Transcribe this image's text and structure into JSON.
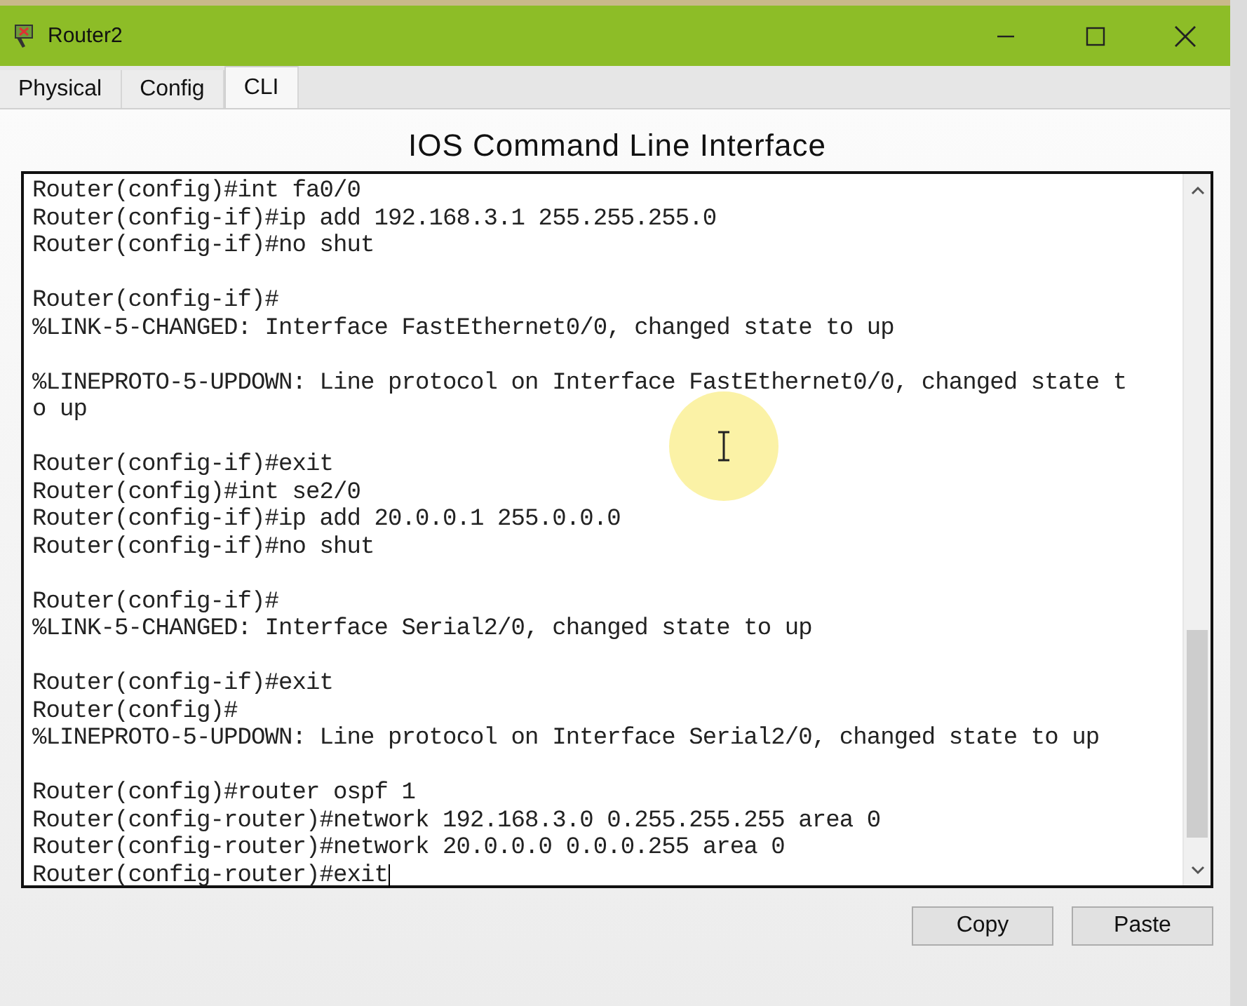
{
  "window": {
    "title": "Router2"
  },
  "tabs": [
    {
      "label": "Physical",
      "selected": false
    },
    {
      "label": "Config",
      "selected": false
    },
    {
      "label": "CLI",
      "selected": true
    }
  ],
  "heading": "IOS Command Line Interface",
  "terminal": {
    "blocks": [
      [
        "Router(config)#int fa0/0",
        "Router(config-if)#ip add 192.168.3.1 255.255.255.0",
        "Router(config-if)#no shut"
      ],
      [
        "Router(config-if)#",
        "%LINK-5-CHANGED: Interface FastEthernet0/0, changed state to up"
      ],
      [
        "%LINEPROTO-5-UPDOWN: Line protocol on Interface FastEthernet0/0, changed state t",
        "o up"
      ],
      [
        "Router(config-if)#exit",
        "Router(config)#int se2/0",
        "Router(config-if)#ip add 20.0.0.1 255.0.0.0",
        "Router(config-if)#no shut"
      ],
      [
        "Router(config-if)#",
        "%LINK-5-CHANGED: Interface Serial2/0, changed state to up"
      ],
      [
        "Router(config-if)#exit",
        "Router(config)#",
        "%LINEPROTO-5-UPDOWN: Line protocol on Interface Serial2/0, changed state to up"
      ],
      [
        "Router(config)#router ospf 1",
        "Router(config-router)#network 192.168.3.0 0.255.255.255 area 0",
        "Router(config-router)#network 20.0.0.0 0.0.0.255 area 0",
        "Router(config-router)#exit"
      ]
    ]
  },
  "buttons": [
    "Copy",
    "Paste"
  ]
}
